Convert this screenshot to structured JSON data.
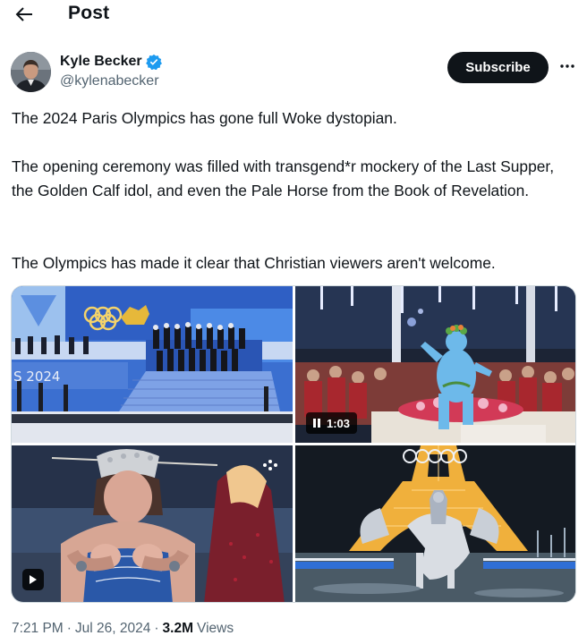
{
  "header": {
    "back_icon": "arrow-left-icon",
    "title": "Post"
  },
  "author": {
    "name": "Kyle Becker",
    "handle": "@kylenabecker",
    "verified_icon": "verified-badge-icon",
    "verified_color": "#1d9bf0"
  },
  "actions": {
    "subscribe_label": "Subscribe",
    "more_icon": "more-horizontal-icon"
  },
  "post": {
    "paragraphs": [
      "The 2024 Paris Olympics has gone full Woke dystopian.",
      "The opening ceremony was filled with transgend*r mockery of the Last Supper, the Golden Calf idol, and even the Pale Horse from the Book of Revelation.",
      "The Olympics has made it clear that Christian viewers aren't welcome."
    ]
  },
  "media": {
    "items": [
      {
        "kind": "image",
        "badge_text": "S 2024"
      },
      {
        "kind": "video",
        "duration": "1:03",
        "badge_icon": "pause-icon"
      },
      {
        "kind": "video",
        "badge_icon": "play-icon"
      },
      {
        "kind": "image"
      }
    ]
  },
  "meta": {
    "time": "7:21 PM",
    "separator": "·",
    "date": "Jul 26, 2024",
    "views_count": "3.2M",
    "views_label": "Views"
  },
  "colors": {
    "text": "#0f1419",
    "secondary": "#536471",
    "button_bg": "#0f1419",
    "border": "#cfd9de"
  }
}
